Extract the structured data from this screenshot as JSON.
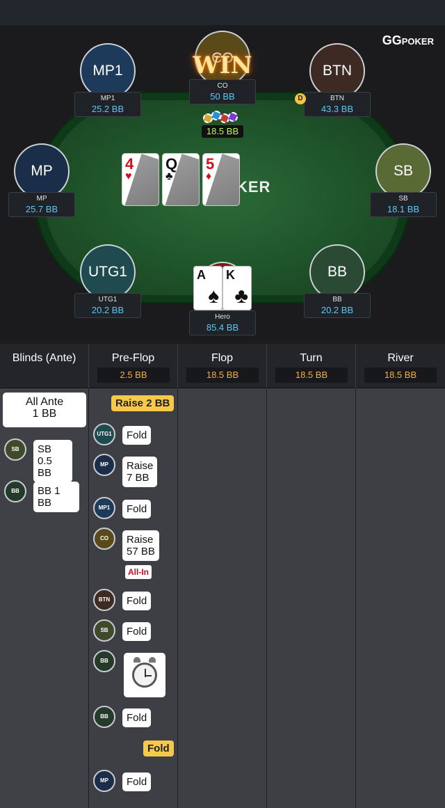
{
  "brand": {
    "logo_main": "GG",
    "logo_sub": "POKER"
  },
  "felt_text": "KER",
  "win_text": "WIN",
  "dealer_button": "D",
  "pot": "18.5 BB",
  "seats": [
    {
      "id": "mp1",
      "avatar": "MP1",
      "name": "MP1",
      "stack": "25.2 BB",
      "color": "#1e3a5a"
    },
    {
      "id": "co",
      "avatar": "CO",
      "name": "CO",
      "stack": "50 BB",
      "color": "#5a4a1a"
    },
    {
      "id": "btn",
      "avatar": "BTN",
      "name": "BTN",
      "stack": "43.3 BB",
      "color": "#3d2a22"
    },
    {
      "id": "mp",
      "avatar": "MP",
      "name": "MP",
      "stack": "25.7 BB",
      "color": "#1a2e4a"
    },
    {
      "id": "sb",
      "avatar": "SB",
      "name": "SB",
      "stack": "18.1 BB",
      "color": "#5a6a34"
    },
    {
      "id": "utg1",
      "avatar": "UTG1",
      "name": "UTG1",
      "stack": "20.2 BB",
      "color": "#1f4a50"
    },
    {
      "id": "hero",
      "avatar": "",
      "name": "Hero",
      "stack": "85.4 BB",
      "color": "#7a1a1a"
    },
    {
      "id": "bb",
      "avatar": "BB",
      "name": "BB",
      "stack": "20.2 BB",
      "color": "#2a4a34"
    }
  ],
  "board": [
    {
      "rank": "4",
      "suit": "♥",
      "color": "red"
    },
    {
      "rank": "Q",
      "suit": "♣",
      "color": "blk"
    },
    {
      "rank": "5",
      "suit": "♦",
      "color": "red"
    }
  ],
  "hero_cards": [
    {
      "rank": "A",
      "suit": "♠"
    },
    {
      "rank": "K",
      "suit": "♣"
    }
  ],
  "history": {
    "columns": [
      {
        "title": "Blinds (Ante)",
        "pot": ""
      },
      {
        "title": "Pre-Flop",
        "pot": "2.5 BB"
      },
      {
        "title": "Flop",
        "pot": "18.5 BB"
      },
      {
        "title": "Turn",
        "pot": "18.5 BB"
      },
      {
        "title": "River",
        "pot": "18.5 BB"
      }
    ],
    "blinds": {
      "ante_label": "All Ante",
      "ante_value": "1 BB",
      "sb_badge": "SB",
      "sb_line1": "SB",
      "sb_line2": "0.5 BB",
      "bb_badge": "BB",
      "bb_text": "BB 1 BB"
    },
    "preflop": {
      "hero_raise": "Raise 2 BB",
      "hero_fold": "Fold",
      "allin": "All-In",
      "actions": [
        {
          "badge": "UTG1",
          "line1": "Fold",
          "line2": ""
        },
        {
          "badge": "MP",
          "line1": "Raise",
          "line2": "7 BB"
        },
        {
          "badge": "MP1",
          "line1": "Fold",
          "line2": ""
        },
        {
          "badge": "CO",
          "line1": "Raise",
          "line2": "57 BB"
        },
        {
          "badge": "BTN",
          "line1": "Fold",
          "line2": ""
        },
        {
          "badge": "SB",
          "line1": "Fold",
          "line2": ""
        },
        {
          "badge": "BB",
          "line1": "",
          "line2": ""
        },
        {
          "badge": "BB",
          "line1": "Fold",
          "line2": ""
        },
        {
          "badge": "MP",
          "line1": "Fold",
          "line2": ""
        }
      ]
    }
  }
}
